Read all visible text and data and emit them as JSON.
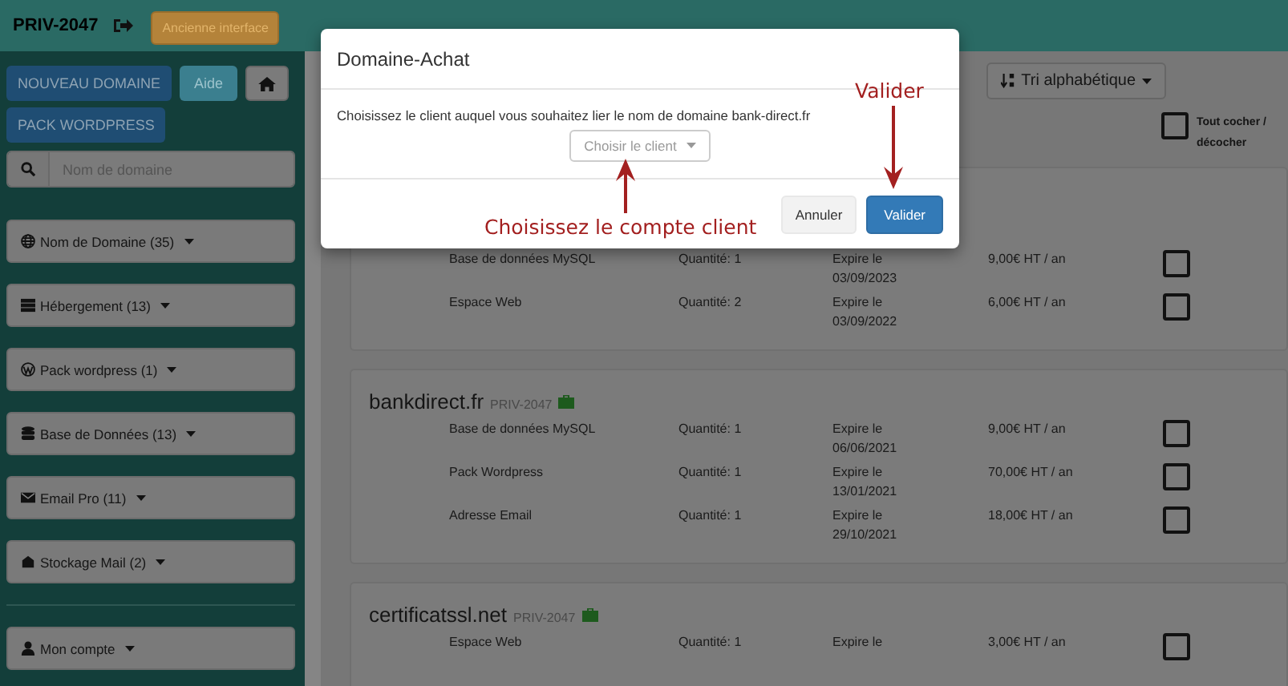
{
  "header": {
    "account": "PRIV-2047",
    "old_interface_button": "Ancienne interface"
  },
  "sidebar": {
    "buttons": [
      {
        "kind": "primary",
        "label": "NOUVEAU DOMAINE"
      },
      {
        "kind": "info",
        "label": "Aide"
      },
      {
        "kind": "home"
      }
    ],
    "pack_button": "PACK WORDPRESS",
    "search": {
      "placeholder": "Nom de domaine"
    },
    "menus": [
      {
        "kind": "globe",
        "label": "Nom de Domaine (35)"
      },
      {
        "kind": "server",
        "label": "Hébergement (13)"
      },
      {
        "kind": "wordpress",
        "label": "Pack wordpress (1)"
      },
      {
        "kind": "database",
        "label": "Base de Données (13)"
      },
      {
        "kind": "envelope",
        "label": "Email Pro (11)"
      },
      {
        "kind": "inbox",
        "label": "Stockage Mail (2)"
      }
    ],
    "account_menu": {
      "kind": "user",
      "label": "Mon compte"
    }
  },
  "toolbar": {
    "sort_button": "Tri alphabétique",
    "select_all": {
      "label": "Tout cocher / décocher",
      "checked": false
    }
  },
  "cards": [
    {
      "rows": [
        {
          "name": "Base de données MySQL",
          "quantity": "Quantité: 1",
          "expiry": "Expire le 03/09/2023",
          "price": "9,00€ HT / an",
          "checked": false
        },
        {
          "name": "Espace Web",
          "quantity": "Quantité: 2",
          "expiry": "Expire le 03/09/2022",
          "price": "6,00€ HT / an",
          "checked": false
        }
      ]
    },
    {
      "title": "bankdirect.fr",
      "account": "PRIV-2047",
      "rows": [
        {
          "name": "Base de données MySQL",
          "quantity": "Quantité: 1",
          "expiry": "Expire le 06/06/2021",
          "price": "9,00€ HT / an",
          "checked": false
        },
        {
          "name": "Pack Wordpress",
          "quantity": "Quantité: 1",
          "expiry": "Expire le 13/01/2021",
          "price": "70,00€ HT / an",
          "checked": false
        },
        {
          "name": "Adresse Email",
          "quantity": "Quantité: 1",
          "expiry": "Expire le 29/10/2021",
          "price": "18,00€ HT / an",
          "checked": false
        }
      ]
    },
    {
      "title": "certificatssl.net",
      "account": "PRIV-2047",
      "rows": [
        {
          "name": "Espace Web",
          "quantity": "Quantité: 1",
          "expiry": "Expire le",
          "price": "3,00€ HT / an",
          "checked": false
        }
      ]
    }
  ],
  "modal": {
    "title": "Domaine-Achat",
    "message": "Choisissez le client auquel vous souhaitez lier le nom de domaine bank-direct.fr",
    "select": {
      "placeholder": "Choisir le client"
    },
    "buttons": [
      {
        "kind": "default",
        "label": "Annuler"
      },
      {
        "kind": "primary",
        "label": "Valider"
      }
    ]
  },
  "annotations": {
    "submit_hint": "Valider",
    "select_hint": "Choisissez le compte client"
  }
}
